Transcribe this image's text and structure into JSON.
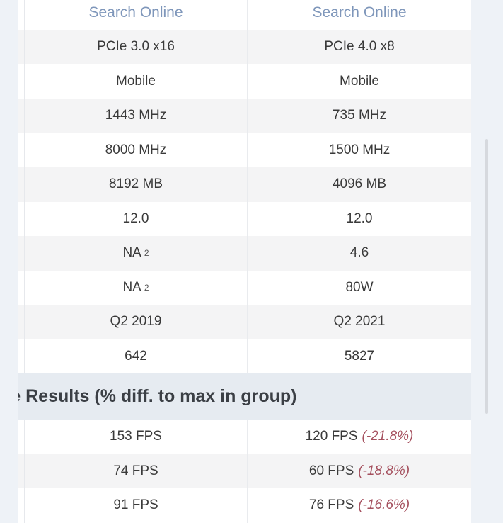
{
  "header": {
    "col1": "Search Online",
    "col2": "Search Online"
  },
  "specs": [
    {
      "col1": "PCIe 3.0 x16",
      "col2": "PCIe 4.0 x8"
    },
    {
      "col1": "Mobile",
      "col2": "Mobile"
    },
    {
      "col1": "1443 MHz",
      "col2": "735 MHz"
    },
    {
      "col1": "8000 MHz",
      "col2": "1500 MHz"
    },
    {
      "col1": "8192 MB",
      "col2": "4096 MB"
    },
    {
      "col1": "12.0",
      "col2": "12.0"
    },
    {
      "col1": "NA",
      "col1_note": "2",
      "col2": "4.6"
    },
    {
      "col1": "NA",
      "col1_note": "2",
      "col2": "80W"
    },
    {
      "col1": "Q2 2019",
      "col2": "Q2 2021"
    },
    {
      "col1": "642",
      "col2": "5827"
    }
  ],
  "section": {
    "title": "ge Results (% diff. to max in group)"
  },
  "benchmarks": [
    {
      "col1": "153 FPS",
      "col2": "120 FPS",
      "col2_diff": "(-21.8%)"
    },
    {
      "col1": "74 FPS",
      "col2": "60 FPS",
      "col2_diff": "(-18.8%)"
    },
    {
      "col1": "91 FPS",
      "col2": "76 FPS",
      "col2_diff": "(-16.6%)"
    }
  ],
  "colors": {
    "link": "#7e96ba",
    "negative_diff": "#a5505e",
    "section_bg": "#e6ebf1"
  }
}
